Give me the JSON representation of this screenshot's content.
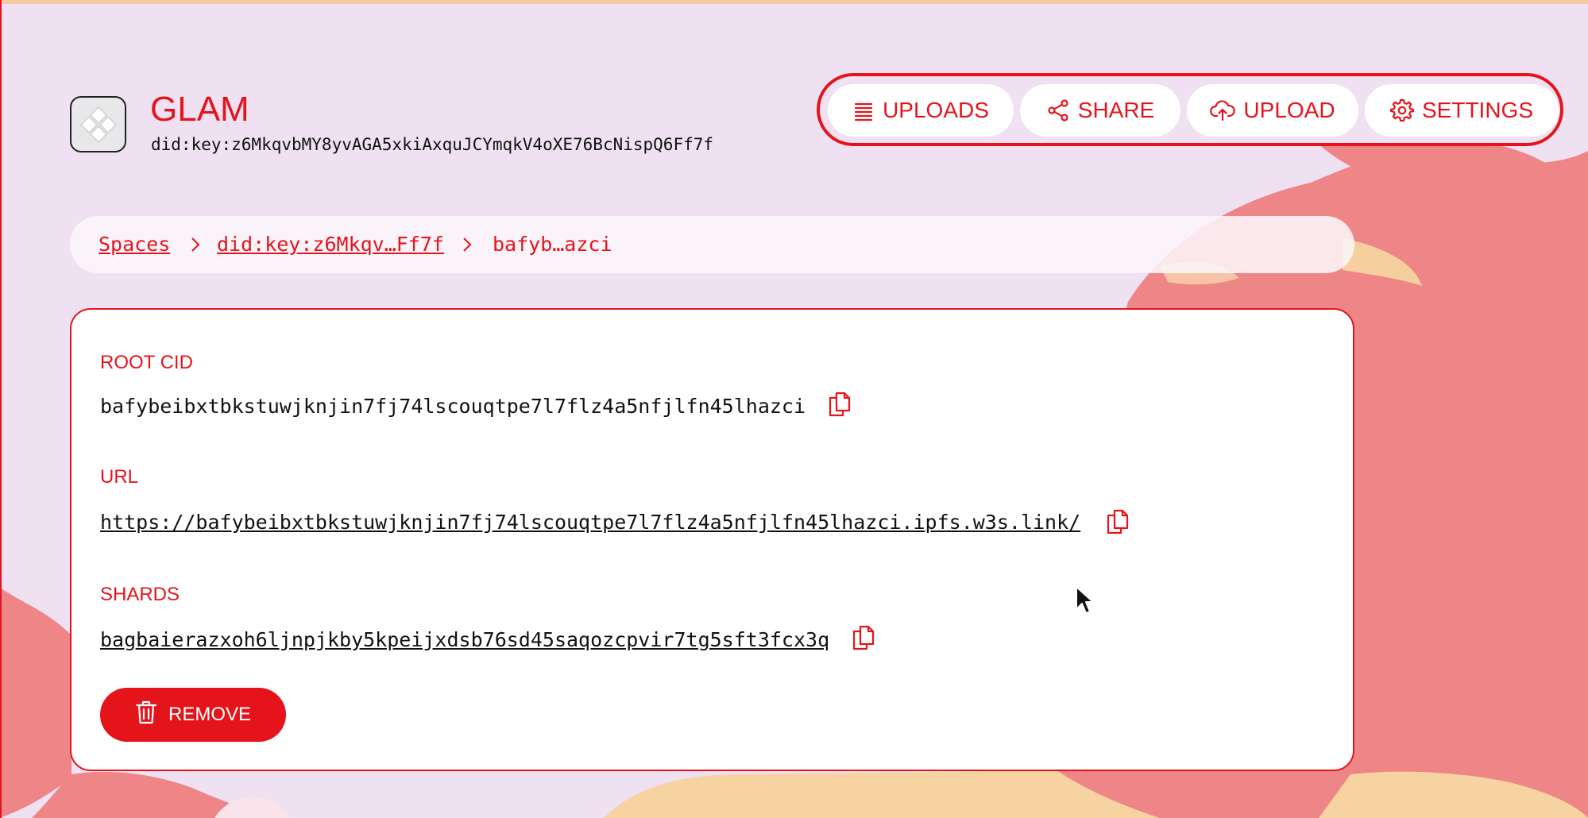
{
  "colors": {
    "accent": "#e5141b",
    "background": "#efe1f2",
    "card": "#ffffff",
    "text": "#111111"
  },
  "header": {
    "logo_icon": "glam-logo-icon",
    "title": "GLAM",
    "did": "did:key:z6MkqvbMY8yvAGA5xkiAxquJCYmqkV4oXE76BcNispQ6Ff7f"
  },
  "nav": {
    "items": [
      {
        "label": "UPLOADS",
        "icon": "list-icon"
      },
      {
        "label": "SHARE",
        "icon": "share-icon"
      },
      {
        "label": "UPLOAD",
        "icon": "cloud-upload-icon"
      },
      {
        "label": "SETTINGS",
        "icon": "gear-icon"
      }
    ]
  },
  "breadcrumb": {
    "items": [
      {
        "label": "Spaces",
        "link": true
      },
      {
        "label": "did:key:z6Mkqv…Ff7f",
        "link": true
      },
      {
        "label": "bafyb…azci",
        "link": false
      }
    ]
  },
  "details": {
    "root_cid": {
      "label": "ROOT CID",
      "value": "bafybeibxtbkstuwjknjin7fj74lscouqtpe7l7flz4a5nfjlfn45lhazci"
    },
    "url": {
      "label": "URL",
      "value": "https://bafybeibxtbkstuwjknjin7fj74lscouqtpe7l7flz4a5nfjlfn45lhazci.ipfs.w3s.link/"
    },
    "shards": {
      "label": "SHARDS",
      "value": "bagbaierazxoh6ljnpjkby5kpeijxdsb76sd45saqozcpvir7tg5sft3fcx3q"
    },
    "remove_label": "REMOVE"
  }
}
